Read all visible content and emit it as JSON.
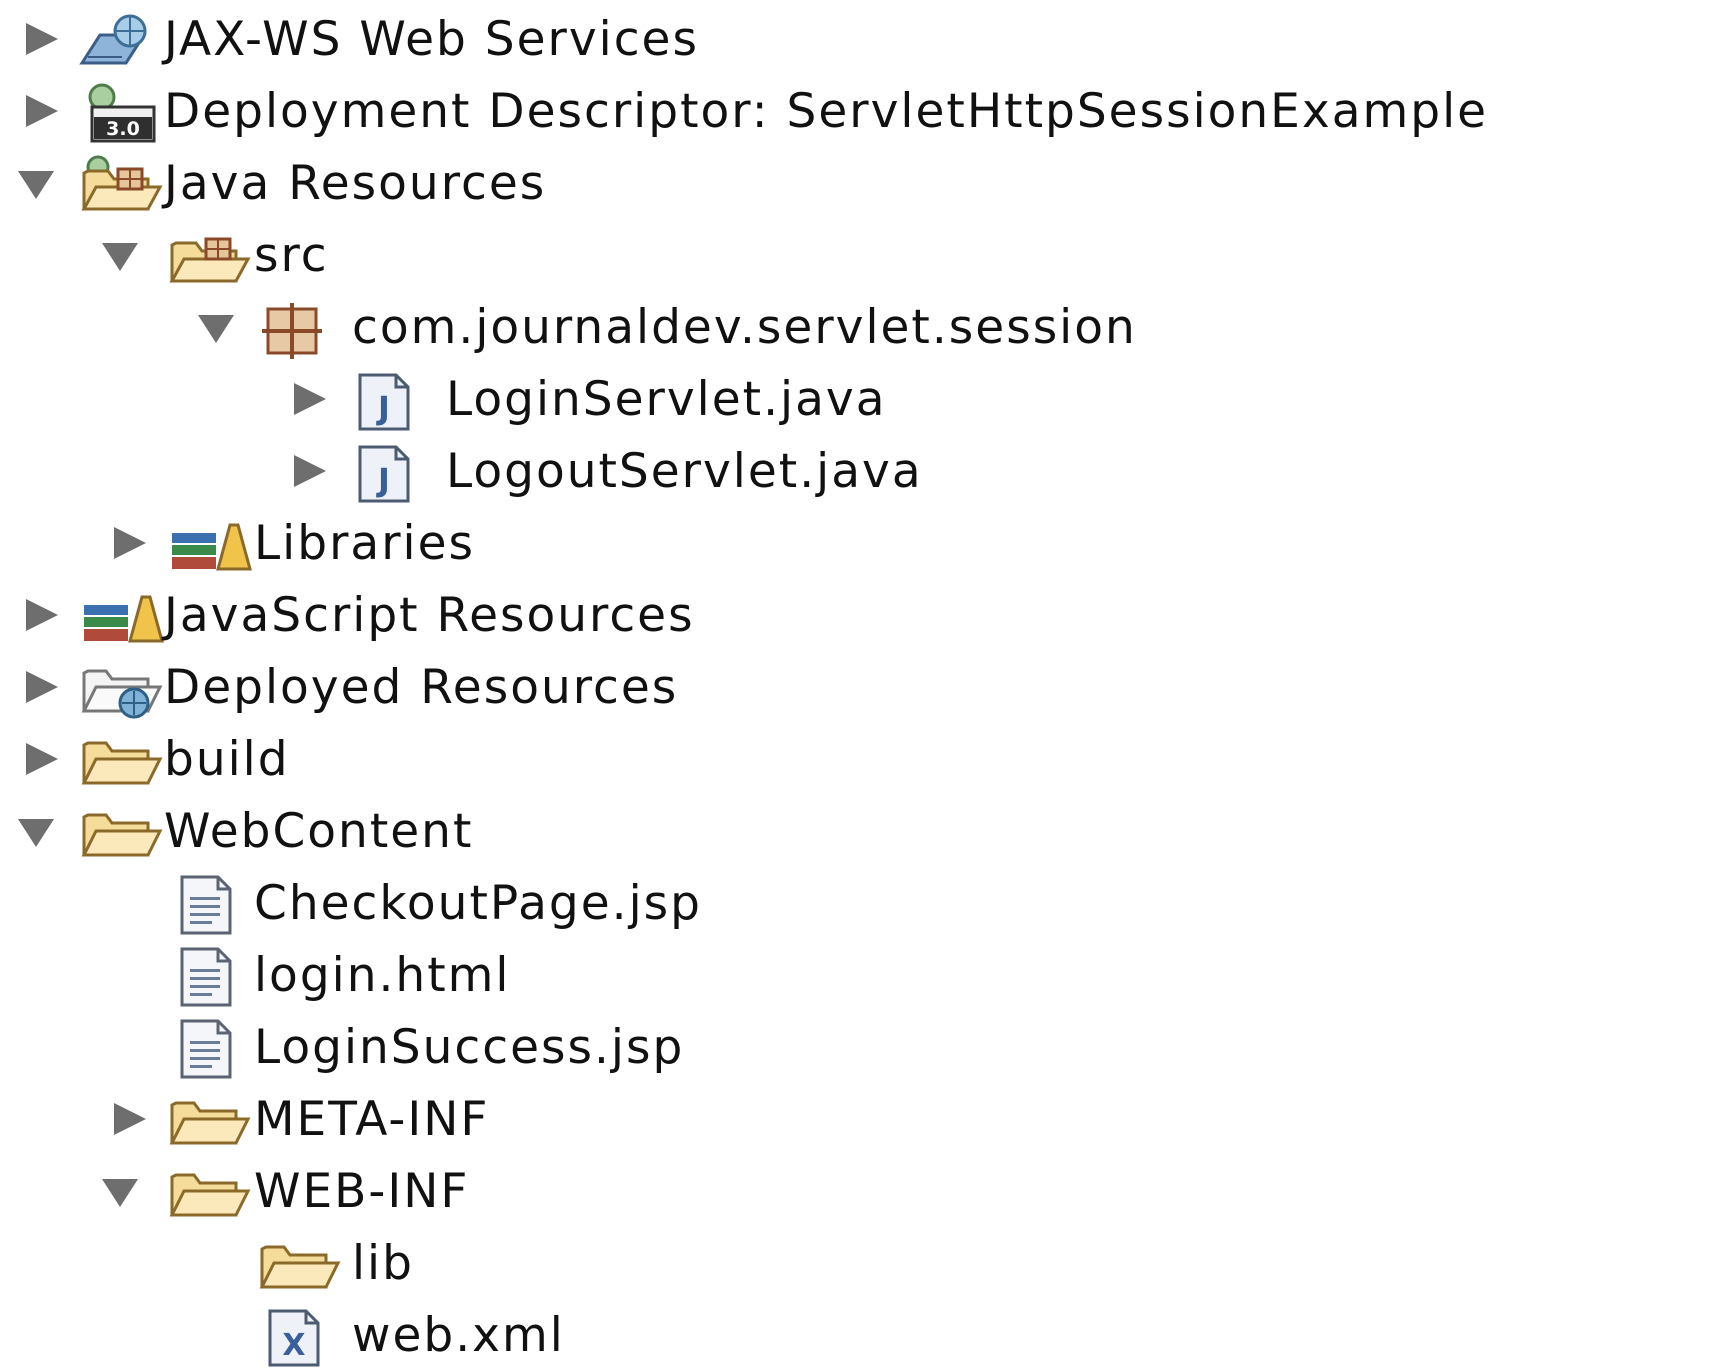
{
  "tree": {
    "jaxws": {
      "label": "JAX-WS Web Services",
      "icon": "web-services-icon",
      "expanded": false
    },
    "deployment": {
      "label": "Deployment Descriptor: ServletHttpSessionExample",
      "icon": "deployment-descriptor-icon",
      "badge": "3.0",
      "expanded": false
    },
    "java_resources": {
      "label": "Java Resources",
      "icon": "java-resources-icon",
      "expanded": true
    },
    "src": {
      "label": "src",
      "icon": "source-folder-icon",
      "expanded": true
    },
    "package": {
      "label": "com.journaldev.servlet.session",
      "icon": "package-icon",
      "expanded": true
    },
    "login_servlet": {
      "label": "LoginServlet.java",
      "icon": "java-file-icon",
      "glyph": "J",
      "expanded": false
    },
    "logout_servlet": {
      "label": "LogoutServlet.java",
      "icon": "java-file-icon",
      "glyph": "J",
      "expanded": false
    },
    "libraries": {
      "label": "Libraries",
      "icon": "libraries-icon",
      "expanded": false
    },
    "js_resources": {
      "label": "JavaScript Resources",
      "icon": "javascript-resources-icon",
      "expanded": false
    },
    "deployed_resources": {
      "label": "Deployed Resources",
      "icon": "deployed-resources-icon",
      "expanded": false
    },
    "build": {
      "label": "build",
      "icon": "folder-icon",
      "expanded": false
    },
    "webcontent": {
      "label": "WebContent",
      "icon": "folder-icon",
      "expanded": true
    },
    "checkout_jsp": {
      "label": "CheckoutPage.jsp",
      "icon": "text-file-icon"
    },
    "login_html": {
      "label": "login.html",
      "icon": "text-file-icon"
    },
    "login_success_jsp": {
      "label": "LoginSuccess.jsp",
      "icon": "text-file-icon"
    },
    "meta_inf": {
      "label": "META-INF",
      "icon": "folder-icon",
      "expanded": false
    },
    "web_inf": {
      "label": "WEB-INF",
      "icon": "folder-icon",
      "expanded": true
    },
    "lib": {
      "label": "lib",
      "icon": "folder-icon"
    },
    "web_xml": {
      "label": "web.xml",
      "icon": "xml-file-icon",
      "glyph": "X"
    }
  },
  "colors": {
    "twisty": "#6e6e6e",
    "folder_fill": "#f9e2a8",
    "folder_stroke": "#8a6a2a",
    "text": "#111111"
  }
}
